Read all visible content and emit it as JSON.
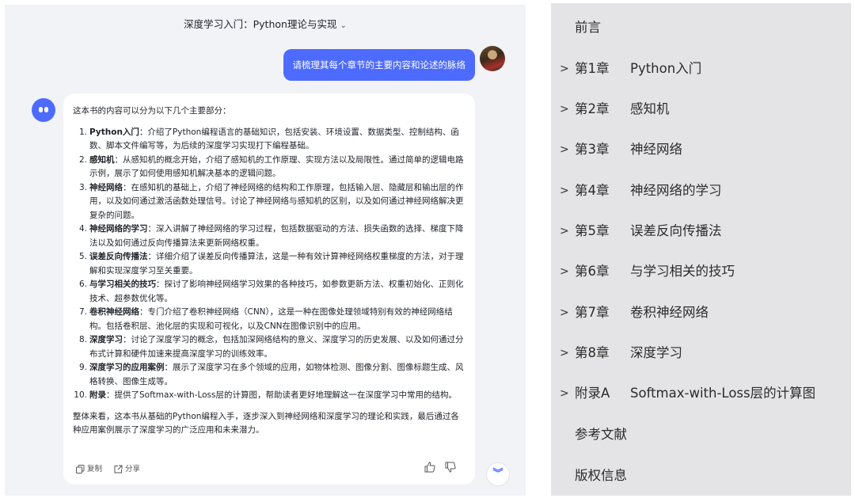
{
  "chat": {
    "title": "深度学习入门：Python理论与实现",
    "user_message": "请梳理其每个章节的主要内容和论述的脉络",
    "intro": "这本书的内容可以分为以下几个主要部分：",
    "items": [
      {
        "num": "1.",
        "head": "Python入门",
        "body": "：介绍了Python编程语言的基础知识，包括安装、环境设置、数据类型、控制结构、函数、脚本文件编写等，为后续的深度学习实现打下编程基础。"
      },
      {
        "num": "2.",
        "head": "感知机",
        "body": "：从感知机的概念开始，介绍了感知机的工作原理、实现方法以及局限性。通过简单的逻辑电路示例，展示了如何使用感知机解决基本的逻辑问题。"
      },
      {
        "num": "3.",
        "head": "神经网络",
        "body": "：在感知机的基础上，介绍了神经网络的结构和工作原理，包括输入层、隐藏层和输出层的作用，以及如何通过激活函数处理信号。讨论了神经网络与感知机的区别，以及如何通过神经网络解决更复杂的问题。"
      },
      {
        "num": "4.",
        "head": "神经网络的学习",
        "body": "：深入讲解了神经网络的学习过程，包括数据驱动的方法、损失函数的选择、梯度下降法以及如何通过反向传播算法来更新网络权重。"
      },
      {
        "num": "5.",
        "head": "误差反向传播法",
        "body": "：详细介绍了误差反向传播算法，这是一种有效计算神经网络权重梯度的方法，对于理解和实现深度学习至关重要。"
      },
      {
        "num": "6.",
        "head": "与学习相关的技巧",
        "body": "：探讨了影响神经网络学习效果的各种技巧，如参数更新方法、权重初始化、正则化技术、超参数优化等。"
      },
      {
        "num": "7.",
        "head": "卷积神经网络",
        "body": "：专门介绍了卷积神经网络（CNN），这是一种在图像处理领域特别有效的神经网络结构。包括卷积层、池化层的实现和可视化，以及CNN在图像识别中的应用。"
      },
      {
        "num": "8.",
        "head": "深度学习",
        "body": "：讨论了深度学习的概念，包括加深网络结构的意义、深度学习的历史发展、以及如何通过分布式计算和硬件加速来提高深度学习的训练效率。"
      },
      {
        "num": "9.",
        "head": "深度学习的应用案例",
        "body": "：展示了深度学习在多个领域的应用，如物体检测、图像分割、图像标题生成、风格转换、图像生成等。"
      },
      {
        "num": "10.",
        "head": "附录",
        "body": "：提供了Softmax-with-Loss层的计算图，帮助读者更好地理解这一在深度学习中常用的结构。"
      }
    ],
    "summary": "整体来看，这本书从基础的Python编程入手，逐步深入到神经网络和深度学习的理论和实践，最后通过各种应用案例展示了深度学习的广泛应用和未来潜力。",
    "actions": {
      "copy": "复制",
      "share": "分享"
    },
    "accent": "#4d6bfe"
  },
  "toc": {
    "rows": [
      {
        "chap": "",
        "title": "前言",
        "expandable": false
      },
      {
        "chap": "第1章",
        "title": "Python入门",
        "expandable": true
      },
      {
        "chap": "第2章",
        "title": "感知机",
        "expandable": true
      },
      {
        "chap": "第3章",
        "title": "神经网络",
        "expandable": true
      },
      {
        "chap": "第4章",
        "title": "神经网络的学习",
        "expandable": true
      },
      {
        "chap": "第5章",
        "title": "误差反向传播法",
        "expandable": true
      },
      {
        "chap": "第6章",
        "title": "与学习相关的技巧",
        "expandable": true
      },
      {
        "chap": "第7章",
        "title": "卷积神经网络",
        "expandable": true
      },
      {
        "chap": "第8章",
        "title": "深度学习",
        "expandable": true
      },
      {
        "chap": "附录A",
        "title": "Softmax-with-Loss层的计算图",
        "expandable": true
      },
      {
        "chap": "",
        "title": "参考文献",
        "expandable": false
      },
      {
        "chap": "",
        "title": "版权信息",
        "expandable": false
      }
    ]
  }
}
